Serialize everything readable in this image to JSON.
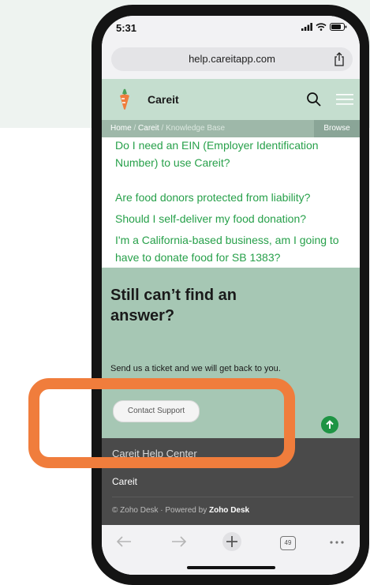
{
  "status_bar": {
    "time": "5:31"
  },
  "browser": {
    "url": "help.careitapp.com",
    "tab_count": "49"
  },
  "site": {
    "brand": "Careit",
    "breadcrumb": {
      "home": "Home",
      "sep1": " / ",
      "section": "Careit",
      "sep2": " / ",
      "current": "Knowledge Base"
    },
    "browse_label": "Browse"
  },
  "faq": {
    "items": [
      "Do I need an EIN (Employer Identification Number) to use Careit?",
      "Are food donors protected from liability?",
      "Should I self-deliver my food donation?",
      "I'm a California-based business, am I going to have to donate food for SB 1383?"
    ]
  },
  "cta": {
    "heading": "Still can’t find an answer?",
    "text": "Send us a ticket and we will get back to you.",
    "button": "Contact Support"
  },
  "footer": {
    "title": "Careit Help Center",
    "link": "Careit",
    "copyright_prefix": "© Zoho Desk · Powered by ",
    "copyright_brand": "Zoho Desk"
  },
  "colors": {
    "header_bg": "#c5decf",
    "link": "#27a04a",
    "cta_bg": "#a6c7b4",
    "footer_bg": "#4a4a4a",
    "highlight": "#f07d3c"
  }
}
